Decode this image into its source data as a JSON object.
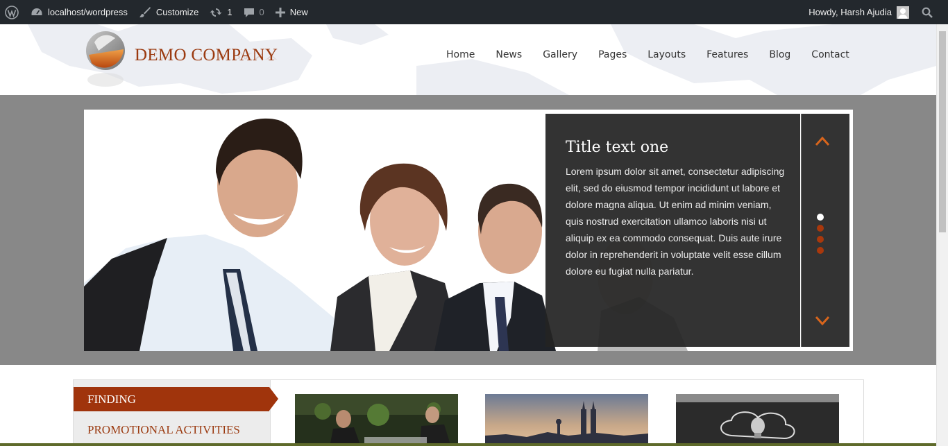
{
  "admin_bar": {
    "site": "localhost/wordpress",
    "customize": "Customize",
    "updates_count": "1",
    "comments_count": "0",
    "new_label": "New",
    "greeting": "Howdy, Harsh Ajudia"
  },
  "header": {
    "brand": "DEMO COMPANY",
    "nav": [
      "Home",
      "News",
      "Gallery",
      "Pages",
      "Layouts",
      "Features",
      "Blog",
      "Contact"
    ]
  },
  "slider": {
    "title": "Title text one",
    "text": "Lorem ipsum dolor sit amet, consectetur adipiscing elit, sed do eiusmod tempor incididunt ut labore et dolore magna aliqua. Ut enim ad minim veniam, quis nostrud exercitation ullamco laboris nisi ut aliquip ex ea commodo consequat. Duis aute irure dolor in reprehenderit in voluptate velit esse cillum dolore eu fugiat nulla pariatur.",
    "slide_count": 4,
    "active_slide": 1
  },
  "content": {
    "tabs": [
      "FINDING",
      "PROMOTIONAL ACTIVITIES"
    ]
  },
  "colors": {
    "accent": "#a0340c",
    "admin_bar": "#23282d",
    "band": "#888888"
  }
}
